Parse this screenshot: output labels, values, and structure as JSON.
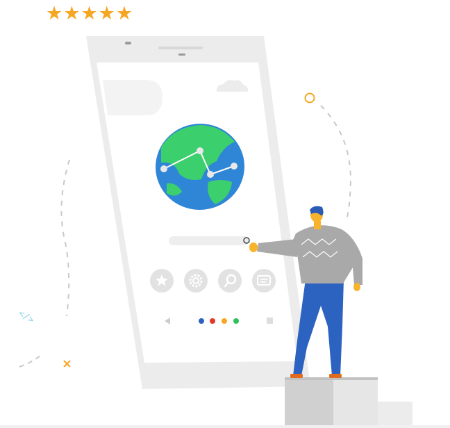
{
  "rating": {
    "stars": 5,
    "max": 5,
    "color": "#f5a623",
    "icon": "star-icon"
  },
  "colors": {
    "phone_frame": "#ececec",
    "phone_screen": "#ffffff",
    "globe_land": "#3ccf6e",
    "globe_water": "#2f86d6",
    "person_pants": "#2c62c0",
    "person_sweater": "#a9a9a9",
    "person_hair": "#2a5bb5",
    "skin": "#f7b32b",
    "dot_colors": [
      "#2d5fc0",
      "#e0392b",
      "#f5a623",
      "#2fbf5b"
    ]
  },
  "app_icons": [
    "star-icon",
    "gear-icon",
    "search-icon",
    "message-icon"
  ],
  "page_indicator": {
    "count": 4,
    "icon_back": "back-triangle-icon",
    "icon_square": "recent-apps-icon"
  },
  "decor": {
    "code_tag": "</>"
  }
}
